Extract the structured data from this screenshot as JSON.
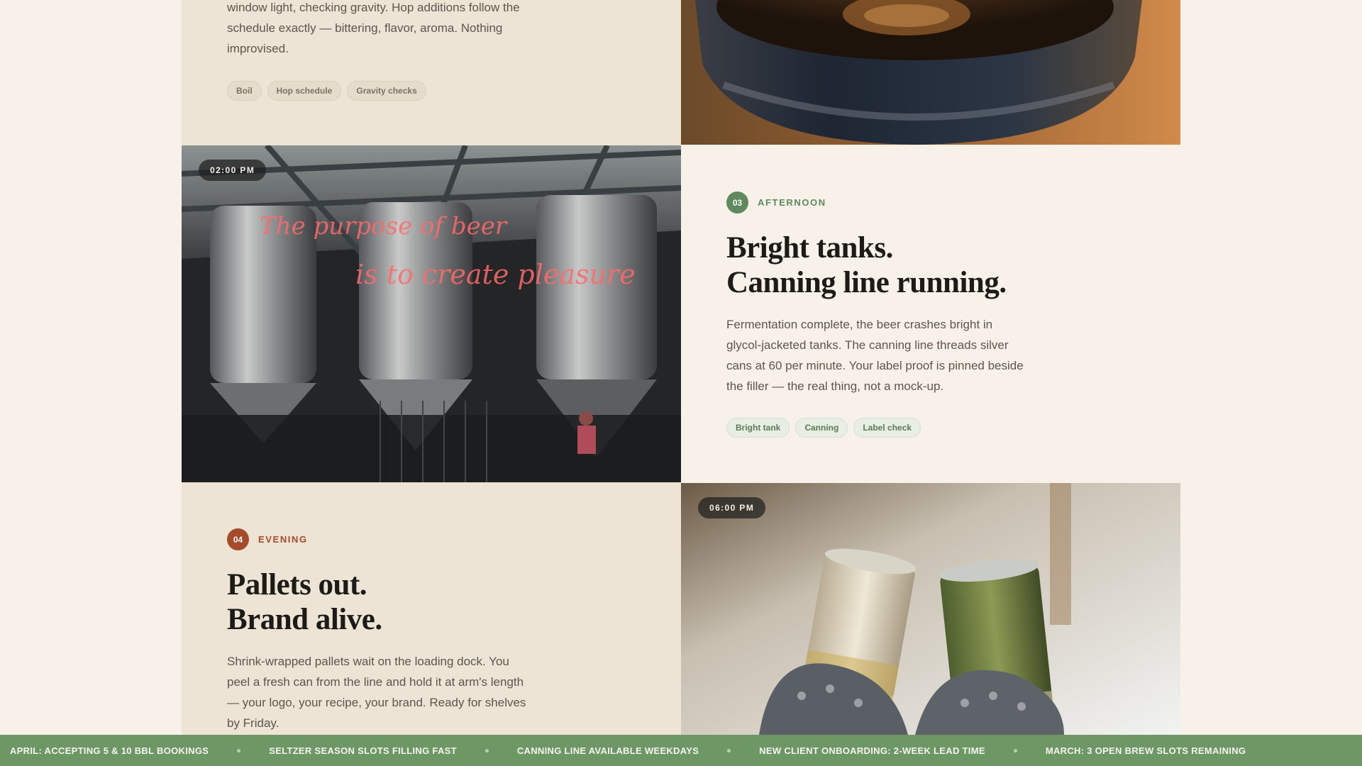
{
  "morning": {
    "body": "window light, checking gravity. Hop additions follow the schedule exactly — bittering, flavor, aroma. Nothing improvised.",
    "tags": [
      "Boil",
      "Hop schedule",
      "Gravity checks"
    ]
  },
  "afternoon": {
    "time": "02:00 PM",
    "step_number": "03",
    "step_label": "AFTERNOON",
    "heading_line1": "Bright tanks.",
    "heading_line2": "Canning line running.",
    "body": "Fermentation complete, the beer crashes bright in glycol-jacketed tanks. The canning line threads silver cans at 60 per minute. Your label proof is pinned beside the filler — the real thing, not a mock-up.",
    "tags": [
      "Bright tank",
      "Canning",
      "Label check"
    ],
    "photo_sign_line1": "The purpose of beer",
    "photo_sign_line2": "is to create pleasure"
  },
  "evening": {
    "time": "06:00 PM",
    "step_number": "04",
    "step_label": "EVENING",
    "heading_line1": "Pallets out.",
    "heading_line2": "Brand alive.",
    "body": "Shrink-wrapped pallets wait on the loading dock. You peel a fresh can from the line and hold it at arm's length — your logo, your recipe, your brand. Ready for shelves by Friday."
  },
  "colors": {
    "accent_green": "#5e8a5e",
    "accent_rust": "#a54a2a",
    "ticker_bg": "#6e9766"
  },
  "ticker": {
    "items": [
      "APRIL: ACCEPTING 5 & 10 BBL BOOKINGS",
      "SELTZER SEASON SLOTS FILLING FAST",
      "CANNING LINE AVAILABLE WEEKDAYS",
      "NEW CLIENT ONBOARDING: 2-WEEK LEAD TIME",
      "MARCH: 3 OPEN BREW SLOTS REMAINING"
    ]
  }
}
